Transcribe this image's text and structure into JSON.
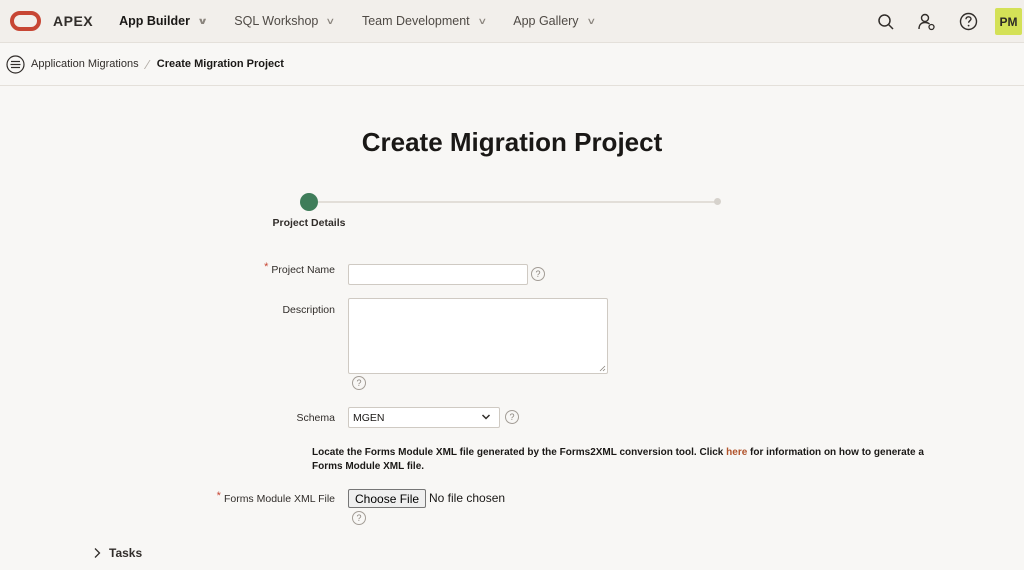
{
  "header": {
    "brand": "APEX",
    "nav": [
      {
        "label": "App Builder",
        "active": true
      },
      {
        "label": "SQL Workshop",
        "active": false
      },
      {
        "label": "Team Development",
        "active": false
      },
      {
        "label": "App Gallery",
        "active": false
      }
    ],
    "user_initials": "PM"
  },
  "breadcrumb": {
    "parent": "Application Migrations",
    "current": "Create Migration Project"
  },
  "page": {
    "title": "Create Migration Project"
  },
  "wizard": {
    "steps": [
      {
        "label": "Project Details",
        "active": true
      },
      {
        "label": "",
        "active": false
      }
    ]
  },
  "form": {
    "project_name": {
      "label": "Project Name",
      "required": true,
      "value": ""
    },
    "description": {
      "label": "Description",
      "value": ""
    },
    "schema": {
      "label": "Schema",
      "value": "MGEN"
    },
    "info": {
      "before": "Locate the Forms Module XML file generated by the Forms2XML conversion tool. Click ",
      "link": "here",
      "after": " for information on how to generate a Forms Module XML file."
    },
    "forms_module_file": {
      "label": "Forms Module XML File",
      "required": true,
      "button_label": "Choose File",
      "status": "No file chosen"
    },
    "help_glyph": "?"
  },
  "tasks": {
    "label": "Tasks"
  },
  "colors": {
    "brand_red": "#c74634",
    "step_active": "#3f7d5a",
    "avatar_bg": "#d4e157",
    "link": "#b0522a"
  }
}
